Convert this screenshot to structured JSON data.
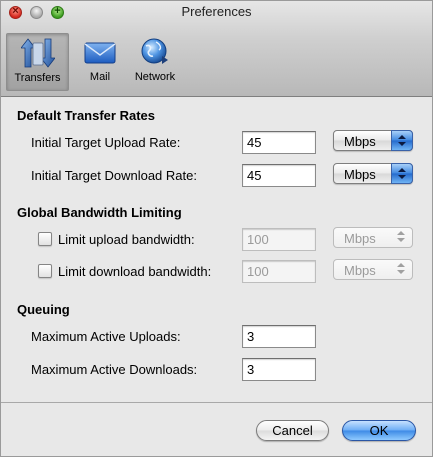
{
  "window": {
    "title": "Preferences"
  },
  "toolbar": {
    "items": [
      {
        "label": "Transfers",
        "icon": "transfers-arrows-icon",
        "selected": true
      },
      {
        "label": "Mail",
        "icon": "envelope-icon",
        "selected": false
      },
      {
        "label": "Network",
        "icon": "globe-network-icon",
        "selected": false
      }
    ]
  },
  "sections": {
    "rates": {
      "title": "Default Transfer Rates",
      "upload_label": "Initial Target Upload Rate:",
      "upload_value": "45",
      "upload_unit": "Mbps",
      "download_label": "Initial Target Download Rate:",
      "download_value": "45",
      "download_unit": "Mbps"
    },
    "bandwidth": {
      "title": "Global Bandwidth Limiting",
      "upload_label": "Limit upload bandwidth:",
      "upload_value": "100",
      "upload_unit": "Mbps",
      "upload_checked": false,
      "download_label": "Limit download bandwidth:",
      "download_value": "100",
      "download_unit": "Mbps",
      "download_checked": false
    },
    "queuing": {
      "title": "Queuing",
      "uploads_label": "Maximum Active Uploads:",
      "uploads_value": "3",
      "downloads_label": "Maximum Active Downloads:",
      "downloads_value": "3"
    }
  },
  "buttons": {
    "cancel": "Cancel",
    "ok": "OK"
  }
}
